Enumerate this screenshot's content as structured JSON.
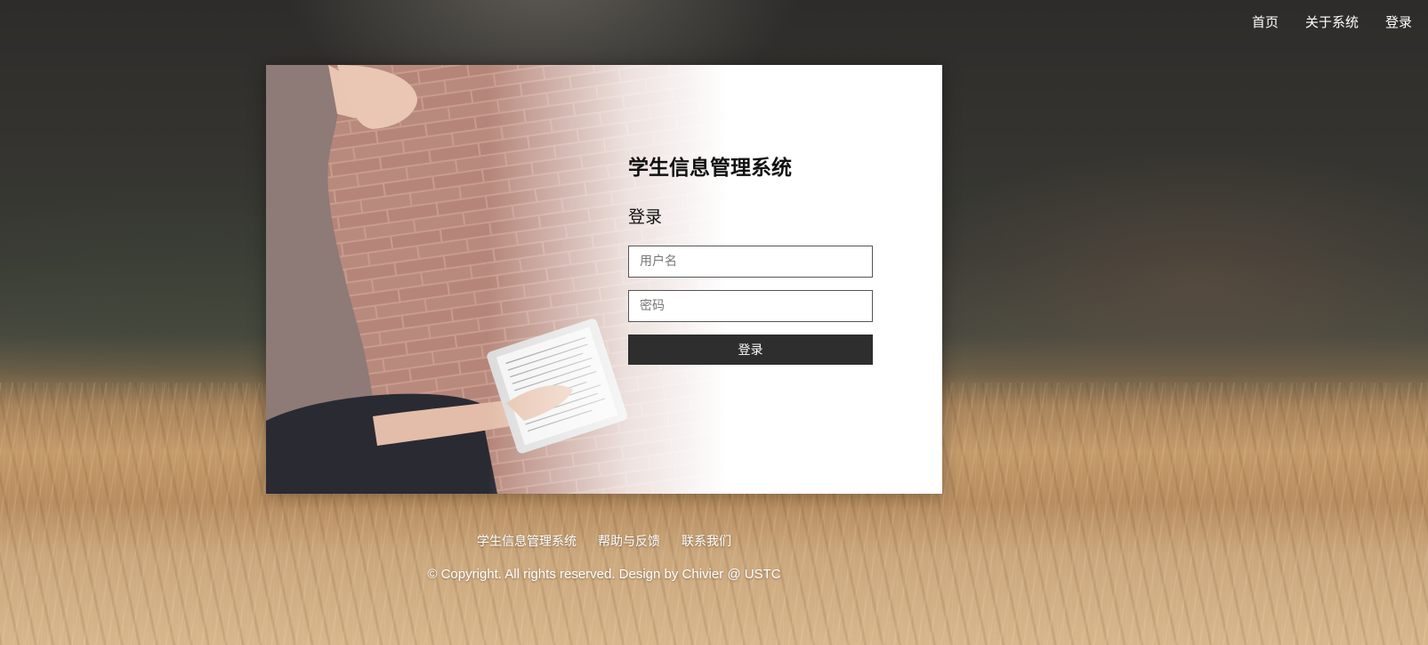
{
  "nav": {
    "items": [
      {
        "label": "首页"
      },
      {
        "label": "关于系统"
      },
      {
        "label": "登录"
      }
    ]
  },
  "login": {
    "title": "学生信息管理系统",
    "subtitle": "登录",
    "username_placeholder": "用户名",
    "username_value": "",
    "password_placeholder": "密码",
    "password_value": "",
    "submit_label": "登录"
  },
  "footer": {
    "links": [
      {
        "label": "学生信息管理系统"
      },
      {
        "label": "帮助与反馈"
      },
      {
        "label": "联系我们"
      }
    ],
    "copyright": "© Copyright. All rights reserved. Design by Chivier @ USTC"
  },
  "colors": {
    "button_bg": "#2e2e2e",
    "card_bg": "#ffffff",
    "text_light": "#ffffff"
  }
}
